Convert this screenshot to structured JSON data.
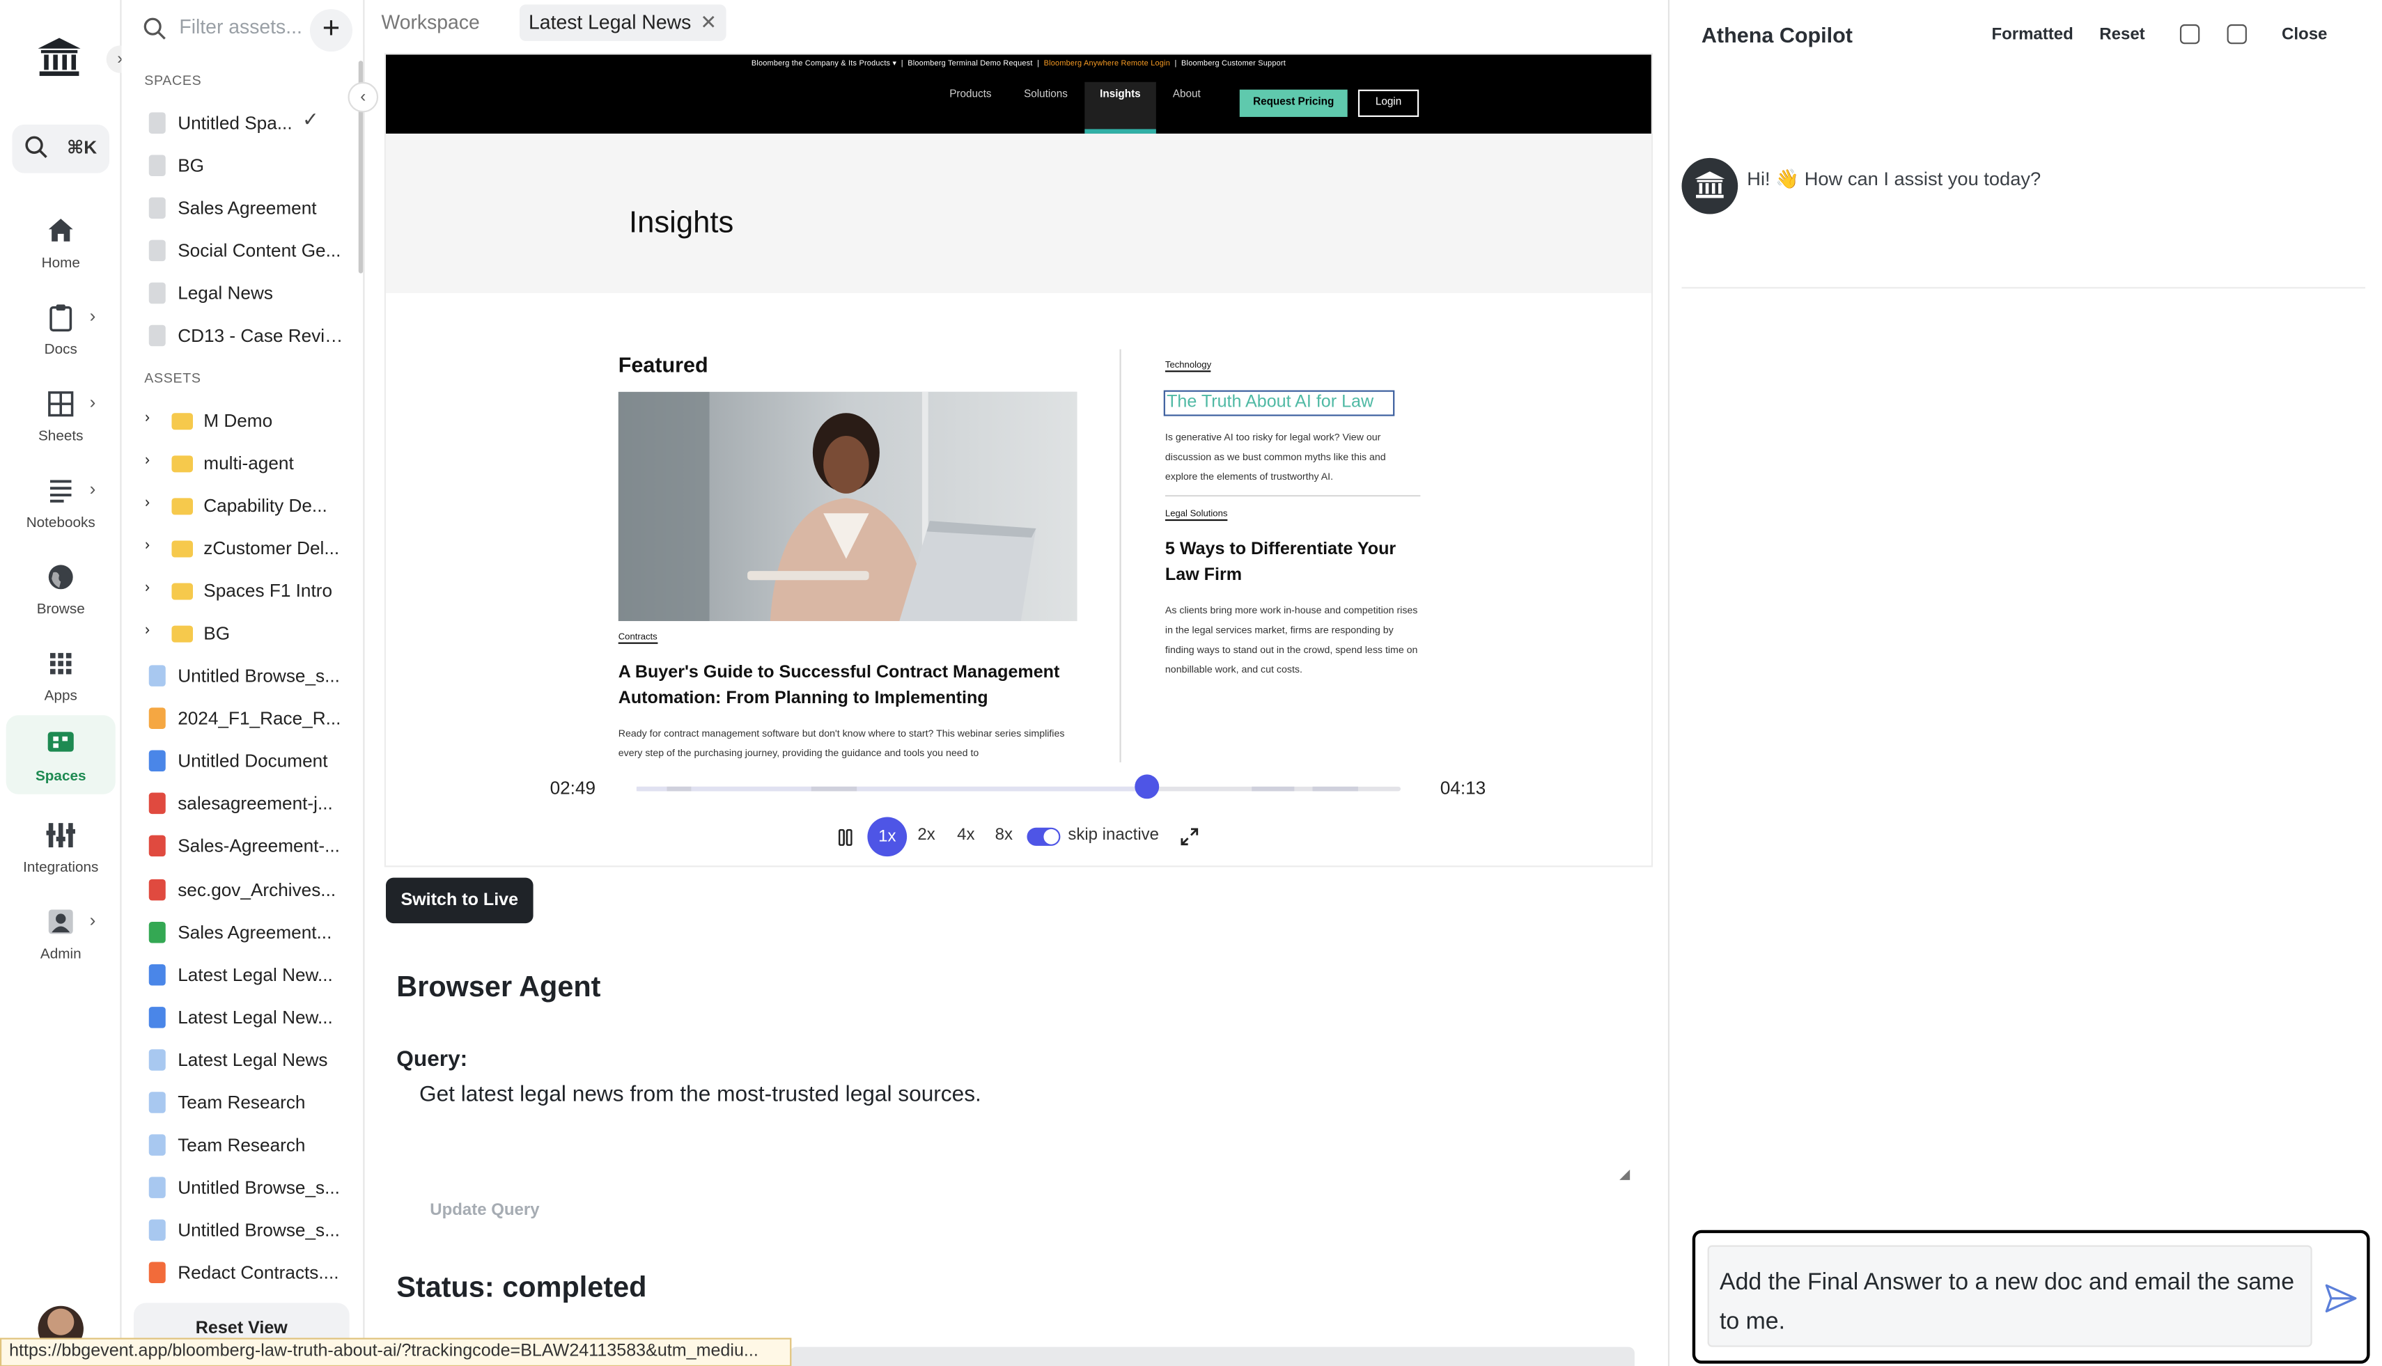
{
  "nav": {
    "search_shortcut": "⌘K",
    "items": [
      {
        "label": "Home",
        "icon": "home-icon"
      },
      {
        "label": "Docs",
        "icon": "clipboard-icon"
      },
      {
        "label": "Sheets",
        "icon": "grid-icon"
      },
      {
        "label": "Notebooks",
        "icon": "list-icon"
      },
      {
        "label": "Browse",
        "icon": "globe-icon"
      },
      {
        "label": "Apps",
        "icon": "apps-icon"
      },
      {
        "label": "Spaces",
        "icon": "spaces-icon",
        "active": true
      },
      {
        "label": "Integrations",
        "icon": "integrations-icon"
      },
      {
        "label": "Admin",
        "icon": "admin-icon"
      }
    ]
  },
  "panel": {
    "filter_placeholder": "Filter assets...",
    "spaces_heading": "SPACES",
    "spaces": [
      "Untitled Spa...",
      "BG",
      "Sales Agreement",
      "Social Content Ge...",
      "Legal News",
      "CD13 - Case Review"
    ],
    "assets_heading": "ASSETS",
    "folders": [
      "M Demo",
      "multi-agent",
      "Capability De...",
      "zCustomer Del...",
      "Spaces F1 Intro",
      "BG"
    ],
    "files": [
      {
        "name": "Untitled Browse_s...",
        "color": "#a8c8f0"
      },
      {
        "name": "2024_F1_Race_R...",
        "color": "#f5a742"
      },
      {
        "name": "Untitled Document",
        "color": "#4a86e8"
      },
      {
        "name": "salesagreement-j...",
        "color": "#e04a3f"
      },
      {
        "name": "Sales-Agreement-...",
        "color": "#e04a3f"
      },
      {
        "name": "sec.gov_Archives...",
        "color": "#e04a3f"
      },
      {
        "name": "Sales Agreement...",
        "color": "#34a853"
      },
      {
        "name": "Latest Legal New...",
        "color": "#4a86e8"
      },
      {
        "name": "Latest Legal New...",
        "color": "#4a86e8"
      },
      {
        "name": "Latest Legal News",
        "color": "#a8c8f0"
      },
      {
        "name": "Team Research",
        "color": "#a8c8f0"
      },
      {
        "name": "Team Research",
        "color": "#a8c8f0"
      },
      {
        "name": "Untitled Browse_s...",
        "color": "#a8c8f0"
      },
      {
        "name": "Untitled Browse_s...",
        "color": "#a8c8f0"
      },
      {
        "name": "Redact Contracts....",
        "color": "#f26b3a"
      }
    ],
    "reset_view": "Reset View"
  },
  "tabs": {
    "workspace": "Workspace",
    "active": "Latest Legal News"
  },
  "site": {
    "util_bar": [
      "Bloomberg the Company & Its Products ▾",
      "Bloomberg Terminal Demo Request",
      "Bloomberg Anywhere Remote Login",
      "Bloomberg Customer Support"
    ],
    "nav": [
      "Products",
      "Solutions",
      "Insights",
      "About"
    ],
    "request_pricing": "Request Pricing",
    "login": "Login",
    "hero_title": "Insights",
    "featured": "Featured",
    "feature_tag": "Contracts",
    "feature_title": "A Buyer's Guide to Successful Contract Management Automation: From Planning to Implementing",
    "feature_desc": "Ready for contract management software but don't know where to start? This webinar series simplifies every step of the purchasing journey, providing the guidance and tools you need to",
    "side1_tag": "Technology",
    "side1_title": "The Truth About AI for Law",
    "side1_desc": "Is generative AI too risky for legal work? View our discussion as we bust common myths like this and explore the elements of trustworthy AI.",
    "side2_tag": "Legal Solutions",
    "side2_title": "5 Ways to Differentiate Your Law Firm",
    "side2_desc": "As clients bring more work in-house and competition rises in the legal services market, firms are responding by finding ways to stand out in the crowd, spend less time on nonbillable work, and cut costs."
  },
  "player": {
    "current": "02:49",
    "total": "04:13",
    "progress": 0.667,
    "speeds": [
      "1x",
      "2x",
      "4x",
      "8x"
    ],
    "skip_inactive": "skip inactive",
    "accent": "#4e55e6"
  },
  "switch_live": "Switch to Live",
  "agent": {
    "heading": "Browser Agent",
    "query_label": "Query:",
    "query": "Get latest legal news from the most-trusted legal sources.",
    "update_query": "Update Query",
    "status": "Status: completed"
  },
  "status_url": "https://bbgevent.app/bloomberg-law-truth-about-ai/?trackingcode=BLAW24113583&utm_mediu...",
  "copilot": {
    "title": "Athena Copilot",
    "formatted": "Formatted",
    "reset": "Reset",
    "close": "Close",
    "greeting": "Hi! 👋 How can I assist you today?",
    "input": "Add the Final Answer to a new doc and email the same to me."
  }
}
